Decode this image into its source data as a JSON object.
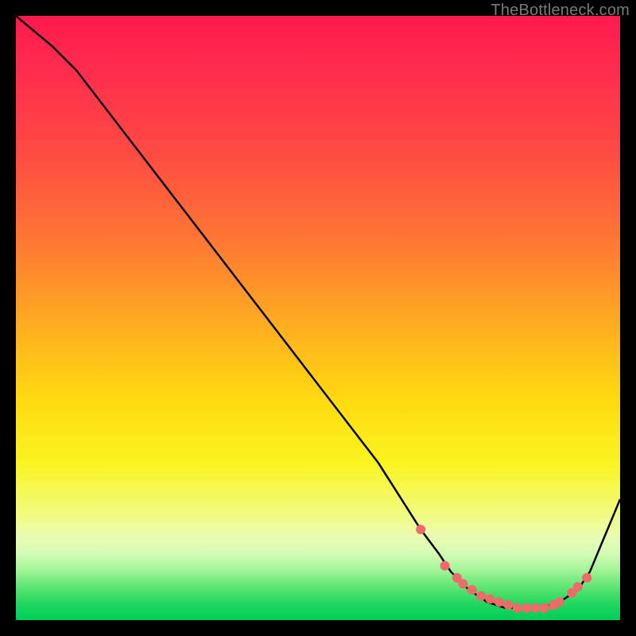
{
  "watermark": "TheBottleneck.com",
  "chart_data": {
    "type": "line",
    "title": "",
    "xlabel": "",
    "ylabel": "",
    "xlim": [
      0,
      100
    ],
    "ylim": [
      0,
      100
    ],
    "grid": false,
    "legend": false,
    "series": [
      {
        "name": "curve",
        "x": [
          0,
          6,
          10,
          20,
          30,
          40,
          50,
          60,
          67,
          70,
          72,
          75,
          78,
          81,
          84,
          87,
          90,
          93,
          95,
          100
        ],
        "values": [
          100,
          95,
          91,
          78,
          65,
          52,
          39,
          26,
          15,
          11,
          8,
          5,
          3,
          2,
          2,
          2,
          3,
          5,
          8,
          20
        ]
      }
    ],
    "markers": {
      "name": "highlight-dots",
      "color": "#f06a6a",
      "x": [
        67,
        71,
        73,
        74,
        75.5,
        77,
        78.5,
        80,
        81.5,
        83,
        84.5,
        86,
        87.5,
        89,
        90,
        92,
        93,
        94.5
      ],
      "values": [
        15,
        9,
        7,
        6,
        5,
        4,
        3.5,
        3,
        2.5,
        2,
        2,
        2,
        2,
        2.5,
        3,
        4.5,
        5.5,
        7
      ]
    }
  }
}
